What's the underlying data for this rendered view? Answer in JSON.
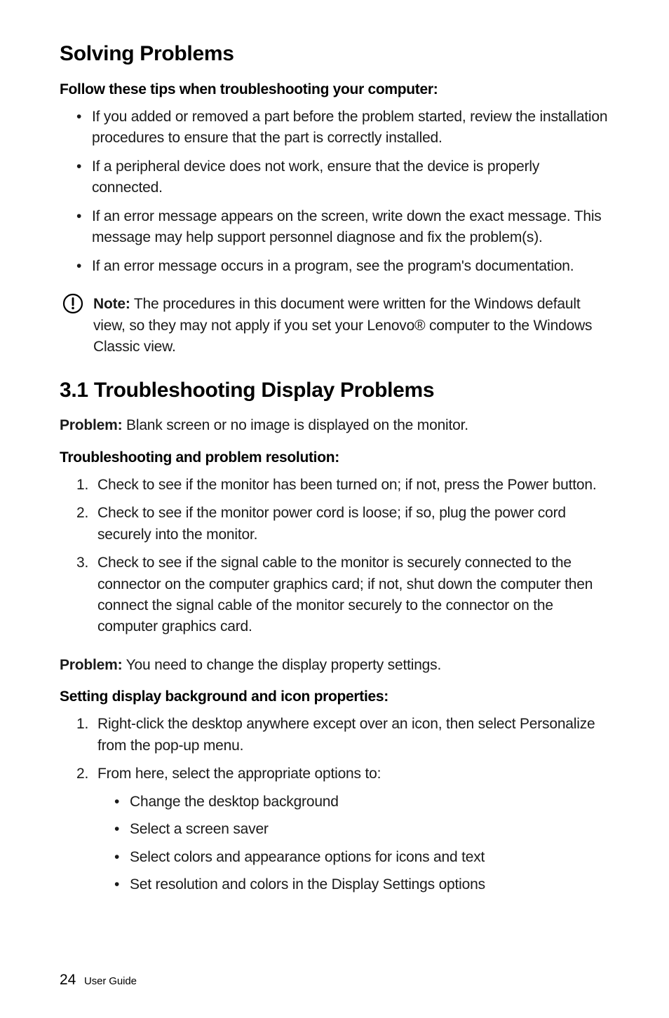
{
  "page": {
    "h1": "Solving Problems",
    "tips_heading": "Follow these tips when troubleshooting your computer:",
    "tips": [
      "If you added or removed a part before the problem started, review the installation procedures to ensure that the part is correctly installed.",
      "If a peripheral device does not work, ensure that the device is properly connected.",
      "If an error message appears on the screen, write down the exact message. This message may help support personnel diagnose and fix the problem(s).",
      "If an error message occurs in a program, see the program's documentation."
    ],
    "note": {
      "label": "Note:",
      "text": " The procedures in this document were written for the Windows default view, so they may not apply if you set your Lenovo® computer to the Windows Classic view."
    },
    "section31": {
      "heading": "3.1   Troubleshooting Display Problems",
      "problem1_label": "Problem:",
      "problem1_text": " Blank screen or no image is displayed on the monitor.",
      "resolution_heading": "Troubleshooting and problem resolution:",
      "steps1": [
        "Check to see if the monitor has been turned on; if not, press the Power button.",
        "Check to see if the monitor power cord is loose; if so, plug the power cord securely into the monitor.",
        "Check to see if the signal cable to the monitor is securely connected to the connector on the computer graphics card; if not, shut down the computer then connect the signal cable of the monitor securely to the connector on the computer graphics card."
      ],
      "problem2_label": "Problem:",
      "problem2_text": " You need to change the display property settings.",
      "setting_heading": "Setting display background and icon properties:",
      "steps2_item1": "Right-click the desktop anywhere except over an icon, then select Personalize from the pop-up menu.",
      "steps2_item2_lead": "From here, select the appropriate options to:",
      "steps2_item2_sub": [
        "Change the desktop background",
        "Select a screen saver",
        "Select colors and appearance options for icons and text",
        "Set resolution and colors in the Display Settings options"
      ]
    },
    "footer": {
      "page_number": "24",
      "title": "User Guide"
    }
  }
}
